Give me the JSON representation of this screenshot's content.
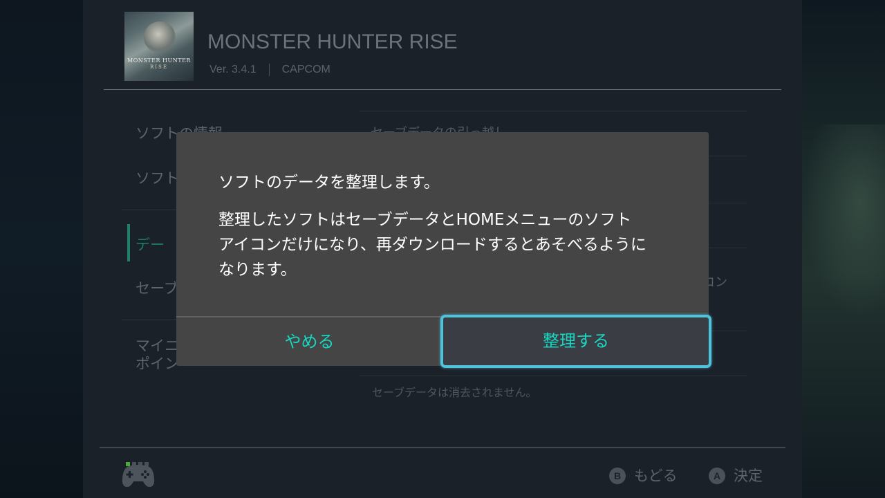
{
  "header": {
    "game_title": "MONSTER HUNTER RISE",
    "version": "Ver. 3.4.1",
    "publisher": "CAPCOM",
    "boxart_logo_line1": "MONSTER HUNTER",
    "boxart_logo_line2": "RISE"
  },
  "sidebar": {
    "items": [
      {
        "label": "ソフトの情報"
      },
      {
        "label": "ソフト"
      },
      {
        "label": "デー"
      },
      {
        "label": "セーブ"
      },
      {
        "label": "マイニ"
      },
      {
        "label": "ポイン"
      }
    ]
  },
  "main": {
    "row1": "セーブデータの引っ越し",
    "row_partial": "コン",
    "note": "セーブデータは消去されません。"
  },
  "dialog": {
    "title": "ソフトのデータを整理します。",
    "body_lines": [
      "整理したソフトはセーブデータとHOMEメニューのソフト",
      "アイコンだけになり、再ダウンロードするとあそべるように",
      "なります。"
    ],
    "cancel_label": "やめる",
    "confirm_label": "整理する"
  },
  "footer": {
    "back_key": "B",
    "back_label": "もどる",
    "ok_key": "A",
    "ok_label": "決定"
  },
  "colors": {
    "accent_teal": "#17d7c0",
    "focus_border": "#4ec3dc",
    "dialog_bg": "#454545",
    "panel_bg": "#1b2129"
  }
}
